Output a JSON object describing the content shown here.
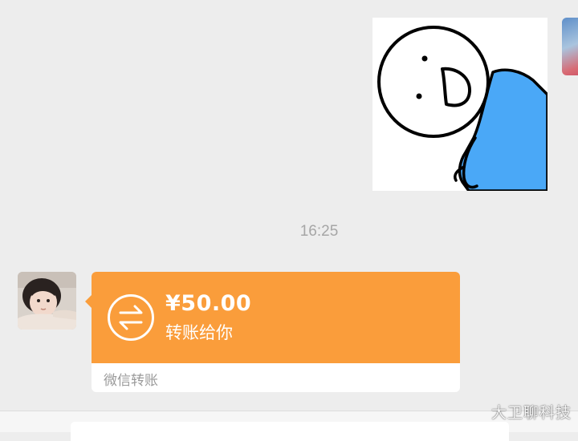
{
  "messages": {
    "sticker": {
      "icon": "leaning-stick-figure-sticker"
    },
    "time_divider": "16:25",
    "transfer": {
      "amount": "¥50.00",
      "description": "转账给你",
      "footer": "微信转账",
      "icon": "transfer-arrows-icon",
      "accent_color": "#fa9d3b"
    }
  },
  "watermark": "大卫聊科技",
  "colors": {
    "background": "#ededed",
    "sticker_blue": "#4aa8f7"
  }
}
